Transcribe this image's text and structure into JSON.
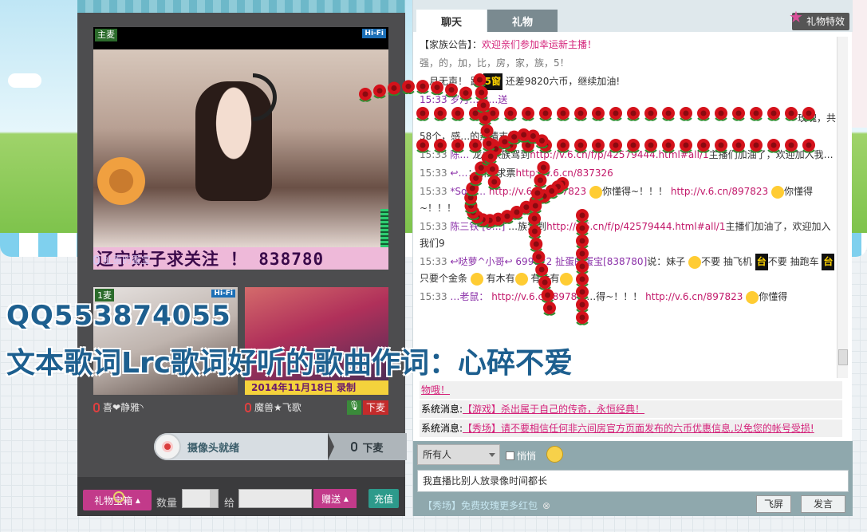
{
  "video": {
    "main_badge": "主麦",
    "hifi": "Hi-Fi",
    "caption": "辽宁妹子求关注 ！ 838780",
    "host_name": "扯蛋的蛋宝",
    "sub1_badge": "1麦",
    "sub1_name": "喜❤静雅◝",
    "sub2_date": "2014年11月18日 录制",
    "sub2_name": "魔兽★飞歌",
    "down_label": "下麦",
    "cam_ready": "摄像头就绪",
    "mic_down": "下麦"
  },
  "gift_bar": {
    "gift_box": "礼物宝箱",
    "qty_label": "数量",
    "to_label": "给",
    "send": "赠送",
    "recharge": "充值"
  },
  "chat": {
    "tab_chat": "聊天",
    "tab_gift": "礼物",
    "gift_fx": "礼物特效",
    "notice_tag": "【家族公告】：",
    "notice_text": "欢迎亲们参加幸运新主播！",
    "line_a": "强，的，加，比，房，家，族，5！",
    "line_b_pre": "…月无声！ 距",
    "line_b_badge": "5窗",
    "line_b_post": "还差9820六币，继续加油!",
    "line_c": "15:33 岁月…向…送",
    "line_d": "玫瑰，共",
    "line_e": "58个，感…的热情支持!",
    "line_f_time": "15:33",
    "line_f_user": "陈…",
    "line_f_text": "龙虎家族驾到",
    "line_f_link": "http://v.6.cn/f/p/42579444.html#all/1",
    "line_f_tail": "主播们加油了，欢迎加入我…",
    "line_g_time": "15:33",
    "line_g_user": "↩…",
    "line_g_text": "：新人求票",
    "line_g_link": "http://v.6.cn/837326",
    "line_h_time": "15:33",
    "line_h_user": "*Som…",
    "line_h_link1": "http://v.6.cn/897823",
    "line_h_text1": "你懂得~！！！",
    "line_h_link2": "http://v.6.cn/897823",
    "line_h_text2": "你懂得~！！！",
    "line_i_time": "15:33",
    "line_i_user": "陈三铁",
    "line_i_id": "[8…]",
    "line_i_text": "…族驾到",
    "line_i_link": "http://v.6.cn/f/p/42579444.html#all/1",
    "line_i_tail": "主播们加油了，欢迎加入我们9",
    "line_j_time": "15:33",
    "line_j_user": "↩哒萝^小哥↩",
    "line_j_id": "699122",
    "line_j_to": "扯蛋的蛋宝",
    "line_j_room": "[838780]",
    "line_j_say": "说：妹子",
    "line_j_t1": "不要 抽飞机",
    "line_j_badge": "台",
    "line_j_t2": "不要 抽跑车",
    "line_j_t3": "只要个金条",
    "line_j_t4": "有木有",
    "line_j_t5": "有木有",
    "line_k_time": "15:33",
    "line_k_user": "…老鼠：",
    "line_k_link1": "http://v.6.cn/8978…",
    "line_k_text1": "…得~！！！",
    "line_k_link2": "http://v.6.cn/897823",
    "line_k_text2": "你懂得"
  },
  "system": {
    "line1": "物哦！",
    "prefix": "系统消息:",
    "line2": "【游戏】杀出属于自己的传奇，永恒经典！",
    "line3": "【秀场】请不要相信任何非六间房官方页面发布的六币优惠信息,以免您的帐号受损!"
  },
  "input": {
    "target": "所有人",
    "whisper": "悄悄",
    "message": "我直播比别人放录像时间都长",
    "promo": "【秀场】免费玫瑰更多红包",
    "fly": "飞屏",
    "send": "发言"
  },
  "watermark": {
    "qq": "QQ553874055",
    "lyrics": "文本歌词Lrc歌词好听的歌曲作词：心碎不爱"
  },
  "colors": {
    "panel_dark": "#4d4d4f",
    "accent_pink": "#c23a8a",
    "link": "#c2186a",
    "teal": "#2d9a8b"
  }
}
